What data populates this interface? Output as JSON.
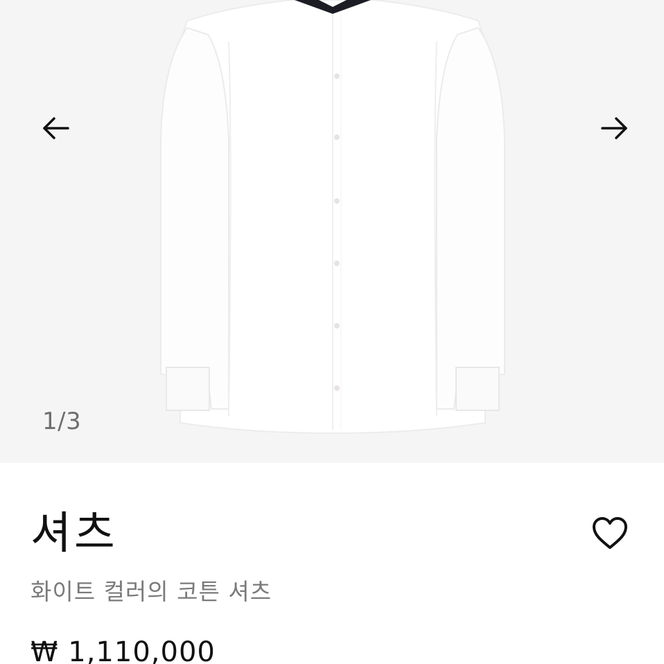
{
  "gallery": {
    "image_alt": "white shirt with contrast collar",
    "pager": "1/3",
    "prev_icon": "arrow-left-icon",
    "next_icon": "arrow-right-icon"
  },
  "product": {
    "title": "셔츠",
    "subtitle": "화이트 컬러의 코튼 셔츠",
    "price": "₩ 1,110,000",
    "wishlist_icon": "heart-outline-icon"
  },
  "colors": {
    "background": "#ffffff",
    "gallery_background": "#f5f5f5",
    "text": "#111111",
    "muted_text": "#7a7a7a"
  }
}
